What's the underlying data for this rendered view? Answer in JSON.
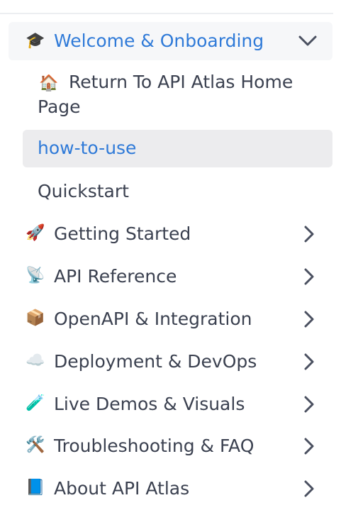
{
  "sidebar": {
    "section": {
      "icon": "graduation-cap-icon",
      "emoji": "🎓",
      "label": "Welcome & Onboarding",
      "expanded": true,
      "accent_color": "#2f7ad8"
    },
    "sub_items": [
      {
        "emoji": "🏠",
        "icon": "house-icon",
        "label": "Return To API Atlas Home Page"
      },
      {
        "label": "how-to-use",
        "active": true
      },
      {
        "label": "Quickstart"
      }
    ],
    "groups": [
      {
        "emoji": "🚀",
        "icon": "rocket-icon",
        "label": "Getting Started"
      },
      {
        "emoji": "📡",
        "icon": "satellite-antenna-icon",
        "label": "API Reference"
      },
      {
        "emoji": "📦",
        "icon": "package-icon",
        "label": "OpenAPI & Integration"
      },
      {
        "emoji": "☁️",
        "icon": "cloud-icon",
        "label": "Deployment & DevOps"
      },
      {
        "emoji": "🧪",
        "icon": "test-tube-icon",
        "label": "Live Demos & Visuals"
      },
      {
        "emoji": "🛠️",
        "icon": "tools-icon",
        "label": "Troubleshooting & FAQ"
      },
      {
        "emoji": "📘",
        "icon": "blue-book-icon",
        "label": "About API Atlas"
      }
    ]
  }
}
